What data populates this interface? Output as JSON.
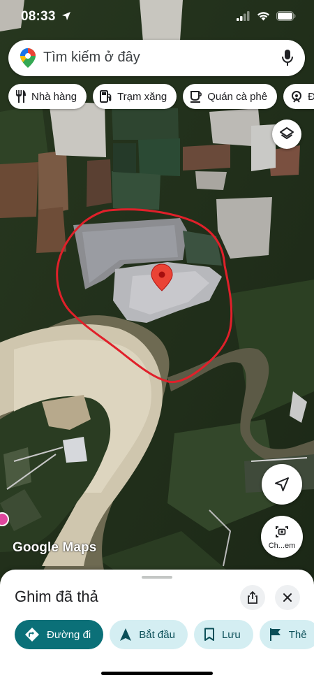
{
  "status_bar": {
    "time": "08:33",
    "icons": [
      "location-arrow-icon",
      "signal-icon",
      "wifi-icon",
      "battery-icon"
    ]
  },
  "search": {
    "placeholder": "Tìm kiếm ở đây",
    "logo_icon": "maps-pin-logo-icon",
    "mic_icon": "mic-icon"
  },
  "chips": [
    {
      "label": "Nhà hàng",
      "icon": "restaurant-icon"
    },
    {
      "label": "Trạm xăng",
      "icon": "gas-station-icon"
    },
    {
      "label": "Quán cà phê",
      "icon": "coffee-icon"
    },
    {
      "label": "Đị",
      "icon": "attraction-icon"
    }
  ],
  "map": {
    "layers_icon": "layers-icon",
    "locate_icon": "navigation-arrow-icon",
    "lens_label": "Ch...em",
    "lens_icon": "camera-search-icon",
    "attribution": "Google Maps",
    "pin_color": "#ea4335",
    "annotation_color": "#e0202a"
  },
  "sheet": {
    "title": "Ghim đã thả",
    "share_icon": "share-icon",
    "close_icon": "close-icon",
    "actions": [
      {
        "label": "Đường đi",
        "icon": "directions-icon",
        "style": "primary"
      },
      {
        "label": "Bắt đầu",
        "icon": "navigation-start-icon",
        "style": "secondary"
      },
      {
        "label": "Lưu",
        "icon": "bookmark-icon",
        "style": "secondary"
      },
      {
        "label": "Thê",
        "icon": "flag-icon",
        "style": "secondary"
      }
    ]
  },
  "colors": {
    "accent": "#0b7078",
    "accent_light": "#d4eef2"
  }
}
